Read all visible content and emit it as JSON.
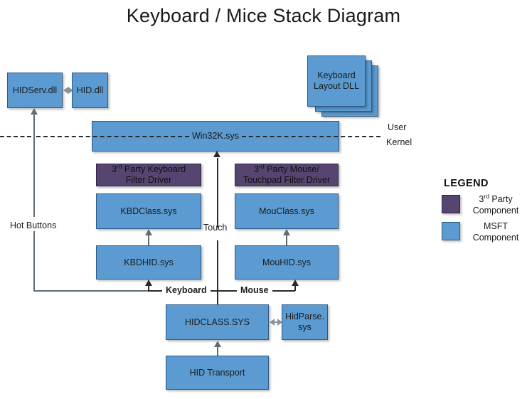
{
  "title": "Keyboard / Mice Stack Diagram",
  "nodes": {
    "hidserv": "HIDServ.dll",
    "hiddll": "HID.dll",
    "keyboard_layout_dll_line1": "Keyboard",
    "keyboard_layout_dll_line2": "Layout DLL",
    "win32k": "Win32K.sys",
    "kbd_filter_line1_pre": "3",
    "kbd_filter_line1_sup": "rd",
    "kbd_filter_line1_post": " Party Keyboard",
    "kbd_filter_line2": "Filter Driver",
    "mou_filter_line1_pre": "3",
    "mou_filter_line1_sup": "rd",
    "mou_filter_line1_post": " Party Mouse/",
    "mou_filter_line2": "Touchpad Filter Driver",
    "kbdclass": "KBDClass.sys",
    "mouclass": "MouClass.sys",
    "kbdhid": "KBDHID.sys",
    "mouhid": "MouHID.sys",
    "hidclass": "HIDCLASS.SYS",
    "hidparse_line1": "HidParse.",
    "hidparse_line2": "sys",
    "hid_transport": "HID Transport"
  },
  "edge_labels": {
    "hot_buttons": "Hot Buttons",
    "touch": "Touch",
    "keyboard": "Keyboard",
    "mouse": "Mouse"
  },
  "boundary": {
    "user": "User",
    "kernel": "Kernel"
  },
  "legend": {
    "heading": "LEGEND",
    "items": [
      {
        "color": "#554570",
        "line1_pre": "3",
        "line1_sup": "rd",
        "line1_post": " Party",
        "line2": "Component"
      },
      {
        "color": "#5b9bd1",
        "line1_pre": "",
        "line1_sup": "",
        "line1_post": "MSFT",
        "line2": "Component"
      }
    ]
  },
  "colors": {
    "msft": "#5b9bd1",
    "third_party": "#554570",
    "connector": "#2a2a2a",
    "background": "#ffffff"
  }
}
